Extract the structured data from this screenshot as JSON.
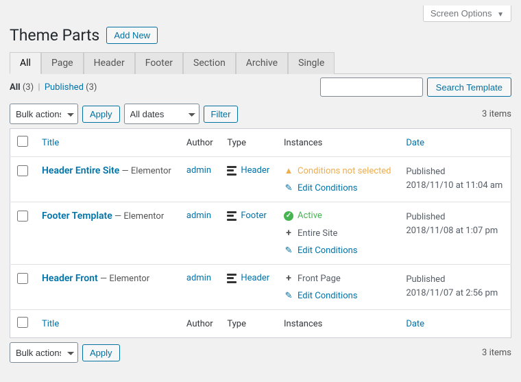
{
  "screen_options": "Screen Options",
  "page_title": "Theme Parts",
  "add_new": "Add New",
  "tabs": [
    "All",
    "Page",
    "Header",
    "Footer",
    "Section",
    "Archive",
    "Single"
  ],
  "active_tab": 0,
  "subsub": {
    "all_label": "All",
    "all_count": "(3)",
    "published_label": "Published",
    "published_count": "(3)"
  },
  "search_btn": "Search Template",
  "bulk_label": "Bulk actions",
  "apply_label": "Apply",
  "dates_label": "All dates",
  "filter_label": "Filter",
  "items_count": "3 items",
  "columns": {
    "title": "Title",
    "author": "Author",
    "type": "Type",
    "instances": "Instances",
    "date": "Date"
  },
  "rows": [
    {
      "title": "Header Entire Site",
      "builder": "Elementor",
      "author": "admin",
      "type": "Header",
      "instances": [
        {
          "kind": "warn",
          "text": "Conditions not selected",
          "link": false
        },
        {
          "kind": "edit",
          "text": "Edit Conditions",
          "link": true
        }
      ],
      "date_word": "Published",
      "date_full": "2018/11/10 at 11:04 am"
    },
    {
      "title": "Footer Template",
      "builder": "Elementor",
      "author": "admin",
      "type": "Footer",
      "instances": [
        {
          "kind": "ok",
          "text": "Active",
          "link": false
        },
        {
          "kind": "plus",
          "text": "Entire Site",
          "link": false
        },
        {
          "kind": "edit",
          "text": "Edit Conditions",
          "link": true
        }
      ],
      "date_word": "Published",
      "date_full": "2018/11/08 at 1:07 pm"
    },
    {
      "title": "Header Front",
      "builder": "Elementor",
      "author": "admin",
      "type": "Header",
      "instances": [
        {
          "kind": "plus",
          "text": "Front Page",
          "link": false
        },
        {
          "kind": "edit",
          "text": "Edit Conditions",
          "link": true
        }
      ],
      "date_word": "Published",
      "date_full": "2018/11/07 at 2:56 pm"
    }
  ]
}
